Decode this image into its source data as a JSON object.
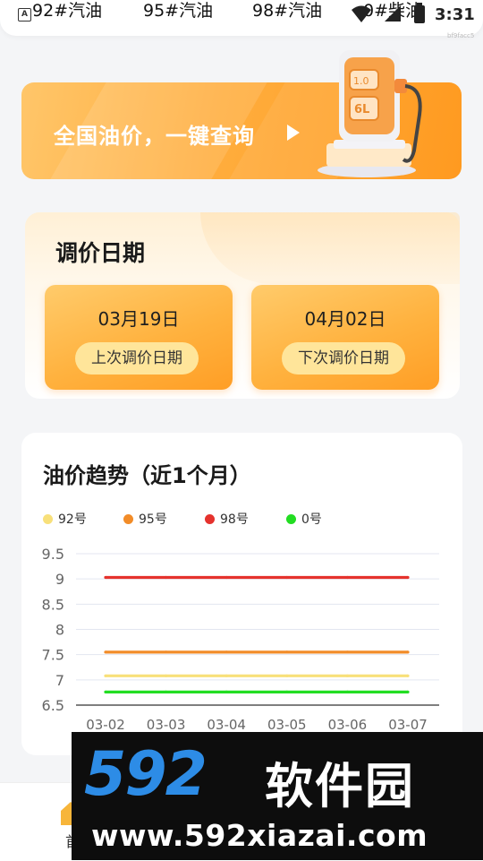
{
  "status_bar": {
    "time": "3:31",
    "app_badge": "A"
  },
  "tabs": [
    "92#汽油",
    "95#汽油",
    "98#汽油",
    "0#柴油"
  ],
  "small_id": "bf9facc5",
  "banner": {
    "text": "全国油价，一键查询",
    "pump_label_top": "1.0",
    "pump_label": "6L"
  },
  "adjust_dates": {
    "title": "调价日期",
    "last": {
      "date": "03月19日",
      "label": "上次调价日期"
    },
    "next": {
      "date": "04月02日",
      "label": "下次调价日期"
    }
  },
  "trend": {
    "title": "油价趋势（近1个月）"
  },
  "chart_data": {
    "type": "line",
    "title": "油价趋势（近1个月）",
    "xlabel": "",
    "ylabel": "",
    "categories": [
      "03-02",
      "03-03",
      "03-04",
      "03-05",
      "03-06",
      "03-07"
    ],
    "ylim": [
      6.5,
      9.5
    ],
    "yticks": [
      9.5,
      9,
      8.5,
      8,
      7.5,
      7,
      6.5
    ],
    "grid": true,
    "legend_position": "top",
    "series": [
      {
        "name": "92号",
        "color": "#f8e07a",
        "values": [
          7.08,
          7.08,
          7.08,
          7.08,
          7.08,
          7.08
        ]
      },
      {
        "name": "95号",
        "color": "#f28c28",
        "values": [
          7.55,
          7.55,
          7.55,
          7.55,
          7.55,
          7.55
        ]
      },
      {
        "name": "98号",
        "color": "#e5322d",
        "values": [
          9.03,
          9.03,
          9.03,
          9.03,
          9.03,
          9.03
        ]
      },
      {
        "name": "0号",
        "color": "#22dd22",
        "values": [
          6.76,
          6.76,
          6.76,
          6.76,
          6.76,
          6.76
        ]
      }
    ]
  },
  "bottom_nav": {
    "home_label": "首"
  },
  "watermark": {
    "numbers": "592",
    "brand": "软件园",
    "url": "www.592xiazai.com"
  }
}
